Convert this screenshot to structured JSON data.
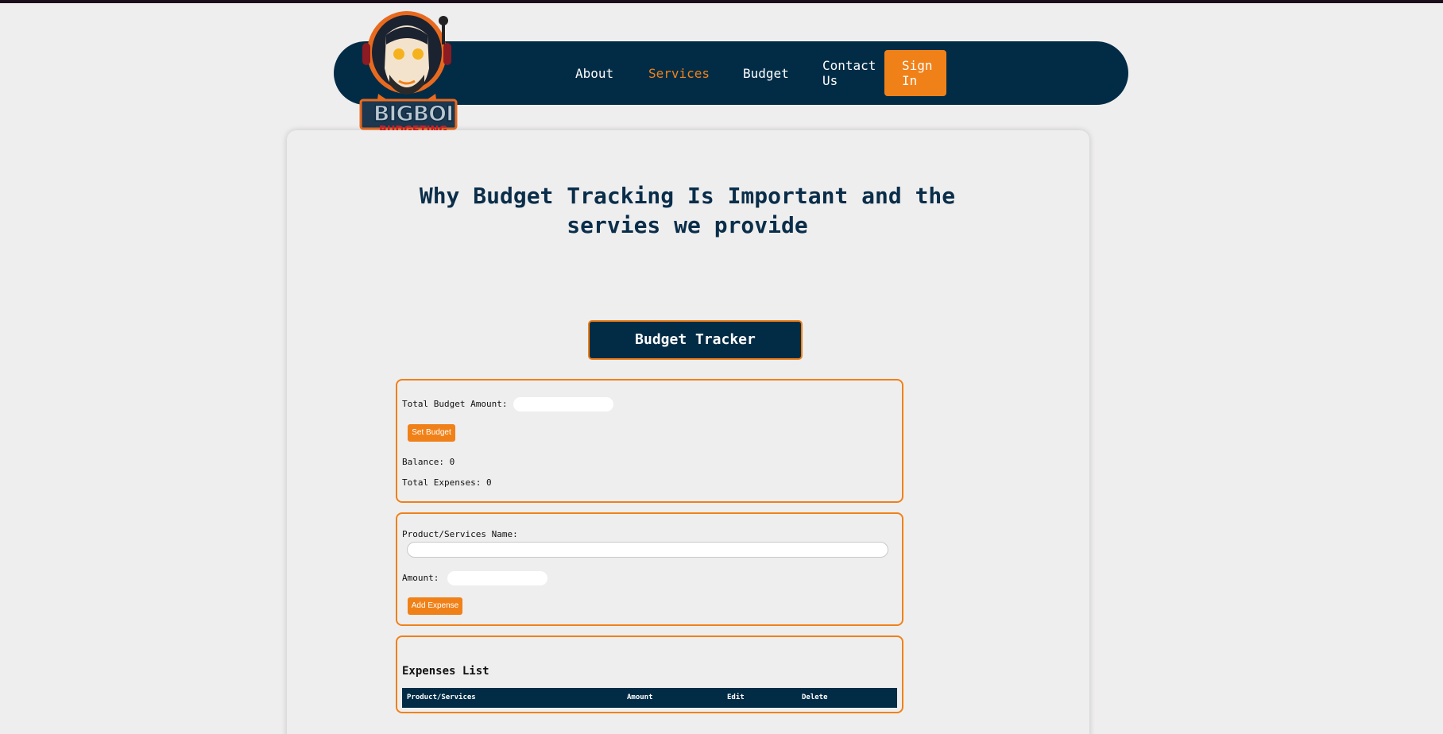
{
  "logo": {
    "word1": "BIGBOI",
    "word2": "BUDGETING"
  },
  "nav": {
    "about": "About",
    "services": "Services",
    "budget": "Budget",
    "contact_line1": "Contact",
    "contact_line2": "Us",
    "signin_line1": "Sign",
    "signin_line2": "In"
  },
  "heading": {
    "line1": "Why Budget Tracking Is Important and the",
    "line2": "servies we provide"
  },
  "tracker": {
    "title": "Budget Tracker",
    "total_budget_label": "Total Budget Amount:",
    "total_budget_value": "",
    "set_budget_button": "Set Budget",
    "balance_label": "Balance: 0",
    "total_expenses_label": "Total Expenses: 0"
  },
  "expense_form": {
    "product_label": "Product/Services Name:",
    "product_value": "",
    "amount_label": "Amount:",
    "amount_value": "",
    "add_button": "Add Expense"
  },
  "expenses": {
    "title": "Expenses List",
    "columns": [
      "Product/Services",
      "Amount",
      "Edit",
      "Delete"
    ]
  },
  "colors": {
    "navy": "#022c46",
    "orange": "#f08119",
    "background": "#efeeee"
  }
}
